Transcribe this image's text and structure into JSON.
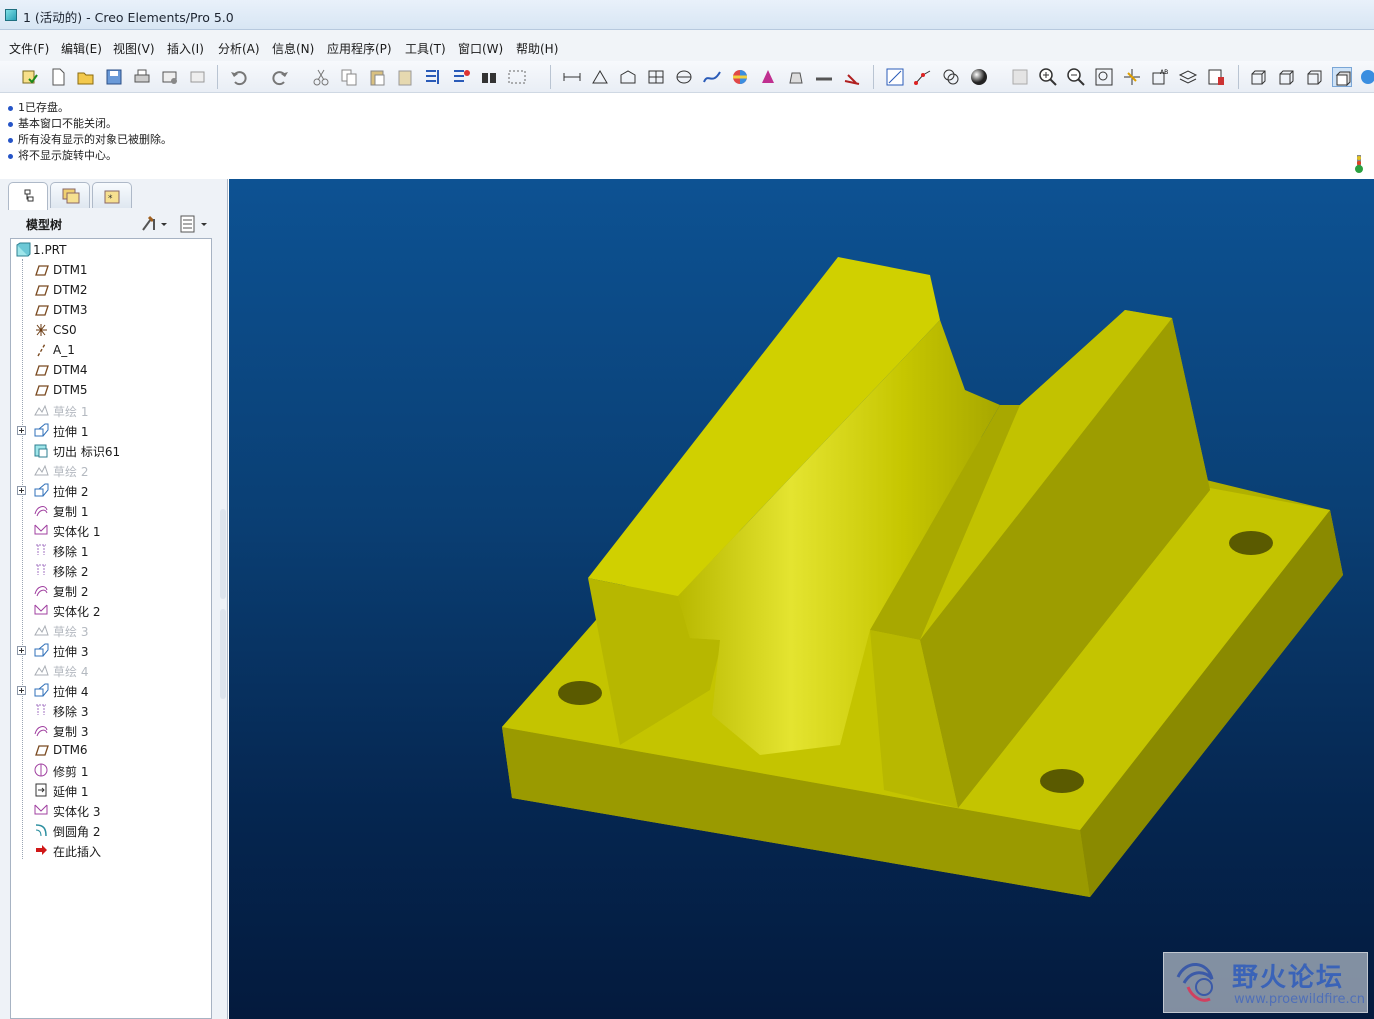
{
  "window": {
    "title": "1 (活动的) - Creo Elements/Pro 5.0"
  },
  "menu": [
    "文件(F)",
    "编辑(E)",
    "视图(V)",
    "插入(I)",
    "分析(A)",
    "信息(N)",
    "应用程序(P)",
    "工具(T)",
    "窗口(W)",
    "帮助(H)"
  ],
  "messages": [
    "1已存盘。",
    "基本窗口不能关闭。",
    "所有没有显示的对象已被删除。",
    "将不显示旋转中心。"
  ],
  "panel": {
    "title": "模型树"
  },
  "tree": [
    {
      "label": "1.PRT",
      "icon": "part-icon",
      "dim": false,
      "expand": false
    },
    {
      "label": "DTM1",
      "icon": "datum-plane-icon",
      "dim": false,
      "expand": false
    },
    {
      "label": "DTM2",
      "icon": "datum-plane-icon",
      "dim": false,
      "expand": false
    },
    {
      "label": "DTM3",
      "icon": "datum-plane-icon",
      "dim": false,
      "expand": false
    },
    {
      "label": "CS0",
      "icon": "coordinate-system-icon",
      "dim": false,
      "expand": false
    },
    {
      "label": "A_1",
      "icon": "datum-axis-icon",
      "dim": false,
      "expand": false
    },
    {
      "label": "DTM4",
      "icon": "datum-plane-icon",
      "dim": false,
      "expand": false
    },
    {
      "label": "DTM5",
      "icon": "datum-plane-icon",
      "dim": false,
      "expand": false
    },
    {
      "label": "草绘 1",
      "icon": "sketch-icon",
      "dim": true,
      "expand": false
    },
    {
      "label": "拉伸 1",
      "icon": "extrude-icon",
      "dim": false,
      "expand": true
    },
    {
      "label": "切出 标识61",
      "icon": "cut-icon",
      "dim": false,
      "expand": false
    },
    {
      "label": "草绘 2",
      "icon": "sketch-icon",
      "dim": true,
      "expand": false
    },
    {
      "label": "拉伸 2",
      "icon": "extrude-icon",
      "dim": false,
      "expand": true
    },
    {
      "label": "复制 1",
      "icon": "copy-icon",
      "dim": false,
      "expand": false
    },
    {
      "label": "实体化 1",
      "icon": "solidify-icon",
      "dim": false,
      "expand": false
    },
    {
      "label": "移除 1",
      "icon": "remove-icon",
      "dim": false,
      "expand": false
    },
    {
      "label": "移除 2",
      "icon": "remove-icon",
      "dim": false,
      "expand": false
    },
    {
      "label": "复制 2",
      "icon": "copy-icon",
      "dim": false,
      "expand": false
    },
    {
      "label": "实体化 2",
      "icon": "solidify-icon",
      "dim": false,
      "expand": false
    },
    {
      "label": "草绘 3",
      "icon": "sketch-icon",
      "dim": true,
      "expand": false
    },
    {
      "label": "拉伸 3",
      "icon": "extrude-icon",
      "dim": false,
      "expand": true
    },
    {
      "label": "草绘 4",
      "icon": "sketch-icon",
      "dim": true,
      "expand": false
    },
    {
      "label": "拉伸 4",
      "icon": "extrude-icon",
      "dim": false,
      "expand": true
    },
    {
      "label": "移除 3",
      "icon": "remove-icon",
      "dim": false,
      "expand": false
    },
    {
      "label": "复制 3",
      "icon": "copy-icon",
      "dim": false,
      "expand": false
    },
    {
      "label": "DTM6",
      "icon": "datum-plane-icon",
      "dim": false,
      "expand": false
    },
    {
      "label": "修剪 1",
      "icon": "trim-icon",
      "dim": false,
      "expand": false
    },
    {
      "label": "延伸 1",
      "icon": "extend-icon",
      "dim": false,
      "expand": false
    },
    {
      "label": "实体化 3",
      "icon": "solidify-icon",
      "dim": false,
      "expand": false
    },
    {
      "label": "倒圆角 2",
      "icon": "round-icon",
      "dim": false,
      "expand": false
    },
    {
      "label": "在此插入",
      "icon": "insert-here-arrow-icon",
      "dim": false,
      "expand": false
    }
  ],
  "watermark": {
    "brand": "野火论坛",
    "url": "www.proewildfire.cn"
  },
  "colors": {
    "model": "#d8d800",
    "viewport_top": "#0d5293",
    "viewport_bottom": "#041a3d"
  }
}
